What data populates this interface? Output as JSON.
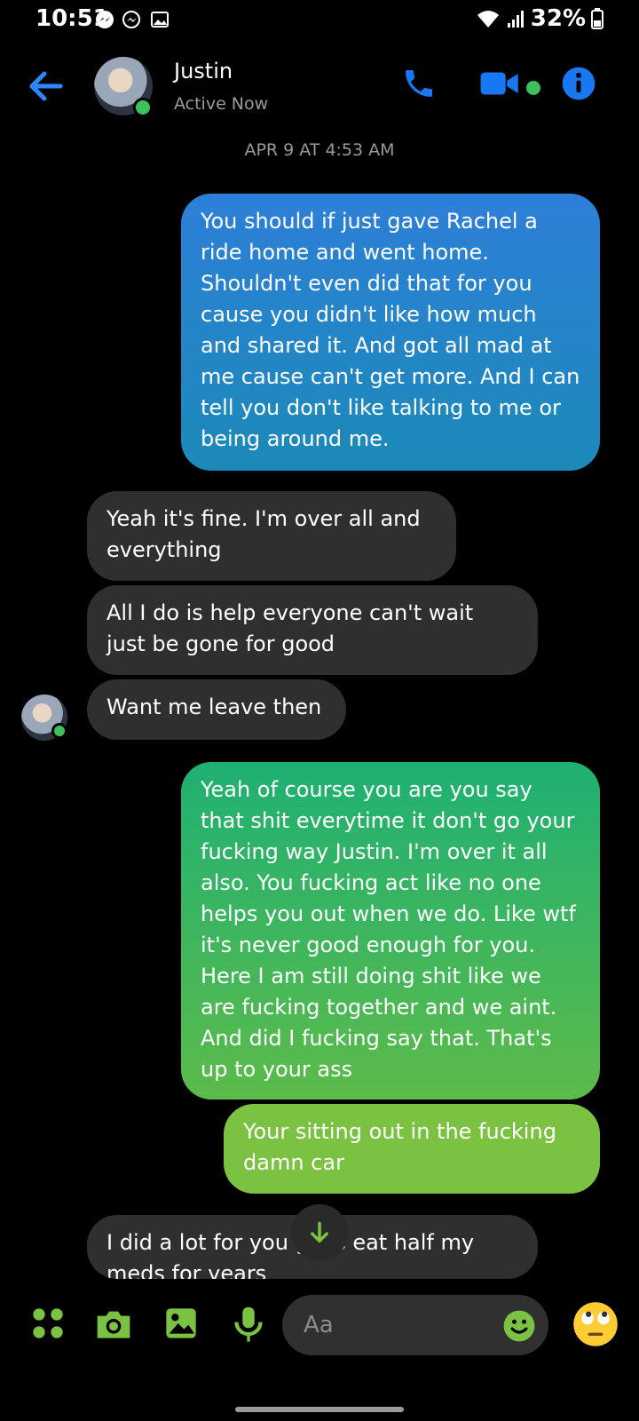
{
  "status_bar": {
    "time": "10:51",
    "battery": "32%"
  },
  "header": {
    "name": "Justin",
    "status": "Active Now"
  },
  "date_separator": "APR 9 AT 4:53 AM",
  "messages": [
    {
      "direction": "out",
      "text": "You should if just gave Rachel a ride home and went home. Shouldn't even did that for you cause you didn't like how much and shared it. And got all mad at me cause can't get more. And I can tell you don't like talking to me or being around me."
    },
    {
      "direction": "in",
      "text": "Yeah it's fine. I'm over all and everything"
    },
    {
      "direction": "in",
      "text": "All I do is help everyone  can't wait just be gone for good"
    },
    {
      "direction": "in",
      "text": "Want me leave then"
    },
    {
      "direction": "out",
      "text": "Yeah of course you are you say that shit everytime it don't go your fucking way Justin. I'm over it all also. You fucking act like no one helps you out when we do. Like wtf it's never good enough for you. Here I am still doing shit like we are fucking together and we aint. And did I fucking say that. That's up to your ass"
    },
    {
      "direction": "out",
      "text": "Your sitting out in the fucking damn car"
    },
    {
      "direction": "in",
      "text": "I did a lot for you guys eat half my meds for years"
    }
  ],
  "composer": {
    "placeholder": "Aa"
  },
  "colors": {
    "accent_blue": "#1877f2",
    "accent_green": "#7bc142"
  }
}
